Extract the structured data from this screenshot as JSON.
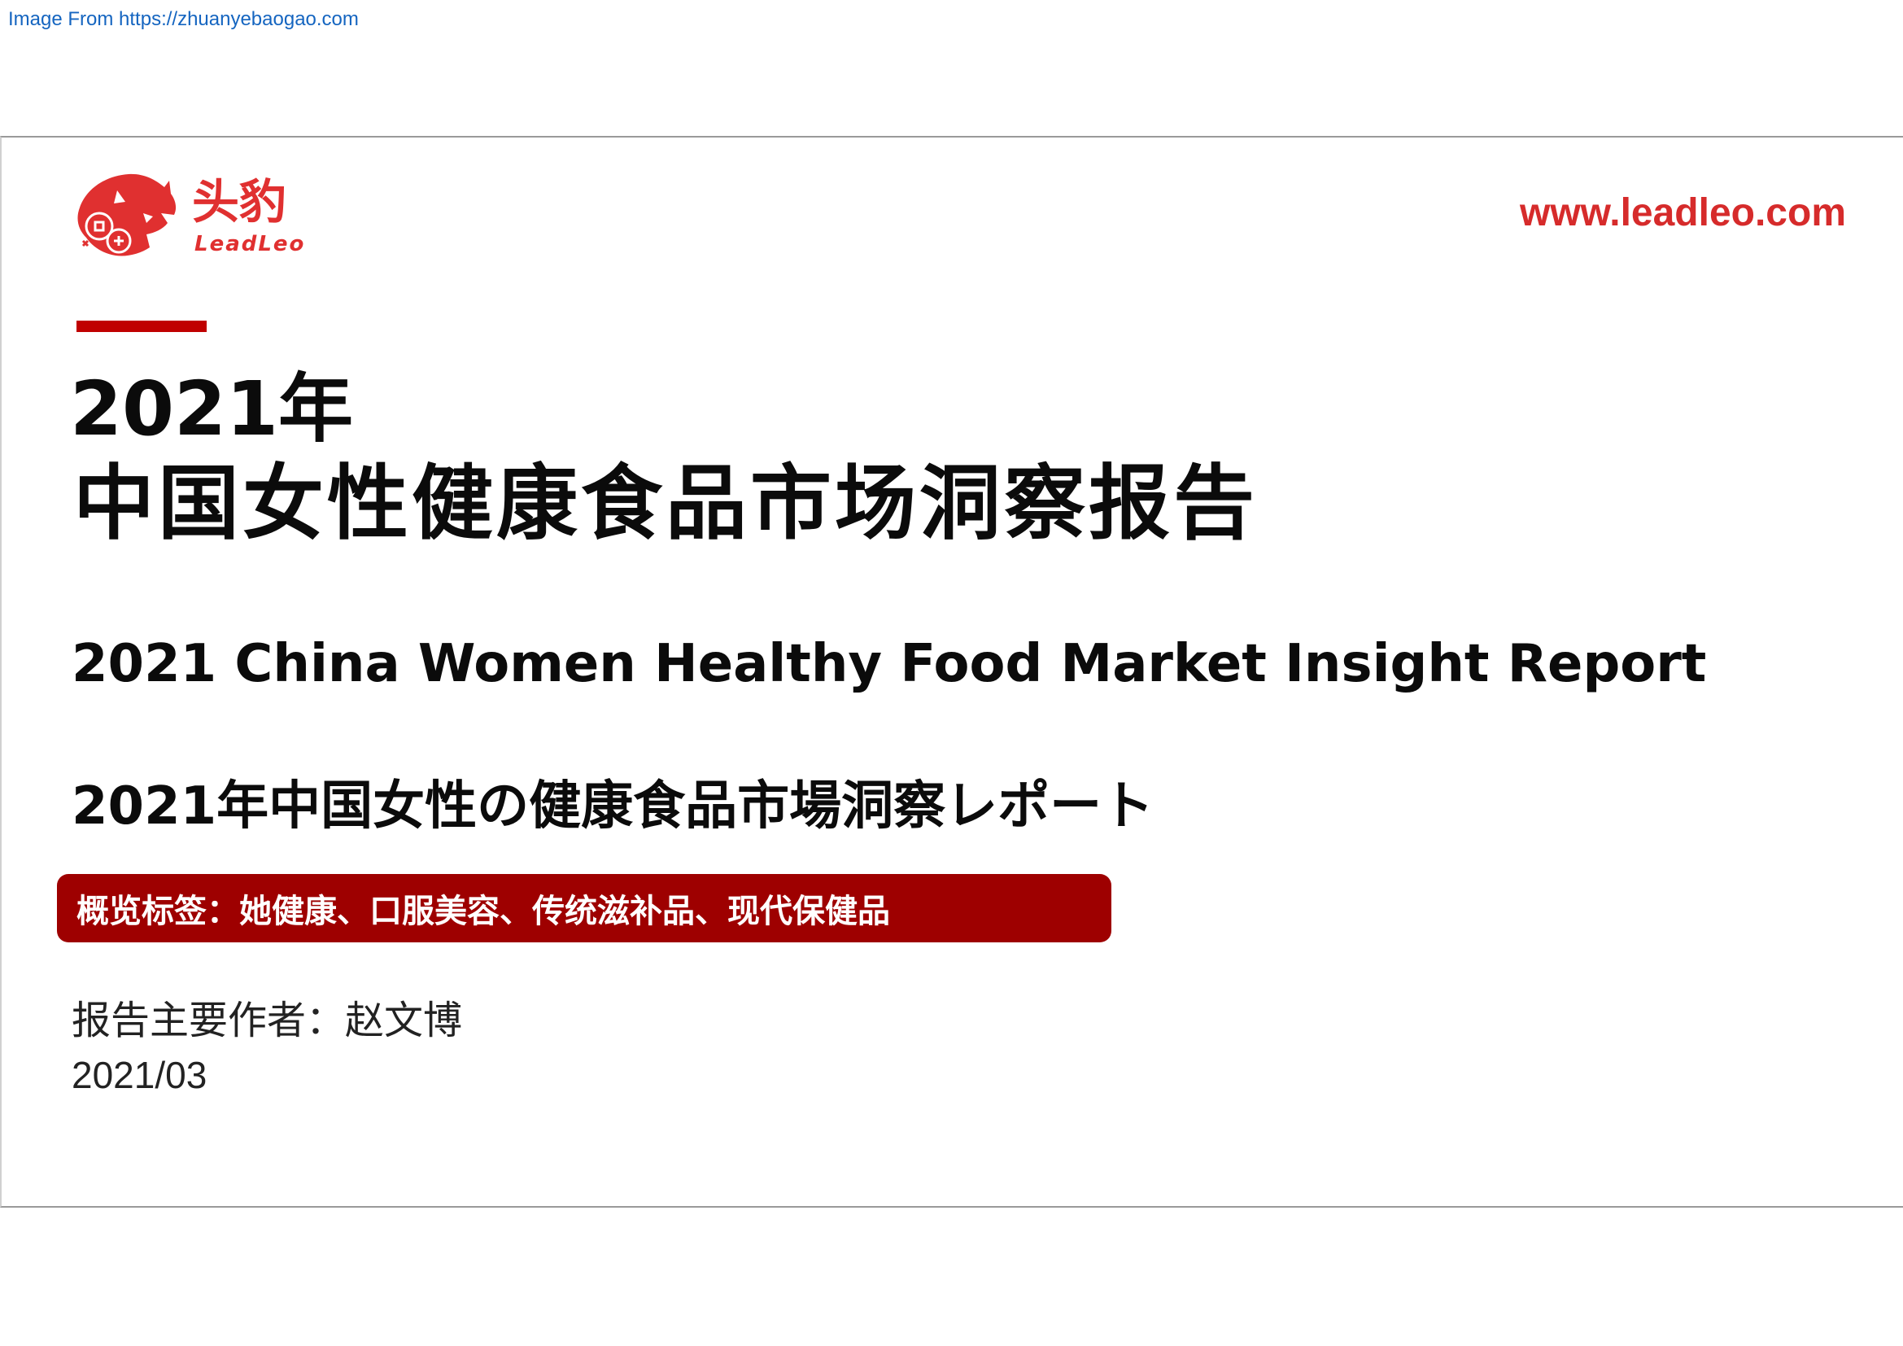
{
  "source_note": "Image From https://zhuanyebaogao.com",
  "brand": {
    "name_cn": "头豹",
    "name_en": "LeadLeo",
    "url": "www.leadleo.com",
    "color": "#d62b2b"
  },
  "title": {
    "year": "2021年",
    "main": "中国女性健康食品市场洞察报告",
    "english": "2021 China Women Healthy Food Market Insight Report",
    "japanese": "2021年中国女性の健康食品市場洞察レポート"
  },
  "tags": {
    "text": "概览标签：她健康、口服美容、传统滋补品、现代保健品",
    "background": "#9e0000"
  },
  "author": {
    "text": "报告主要作者：赵文博"
  },
  "date": "2021/03",
  "accent_color": "#c00000"
}
